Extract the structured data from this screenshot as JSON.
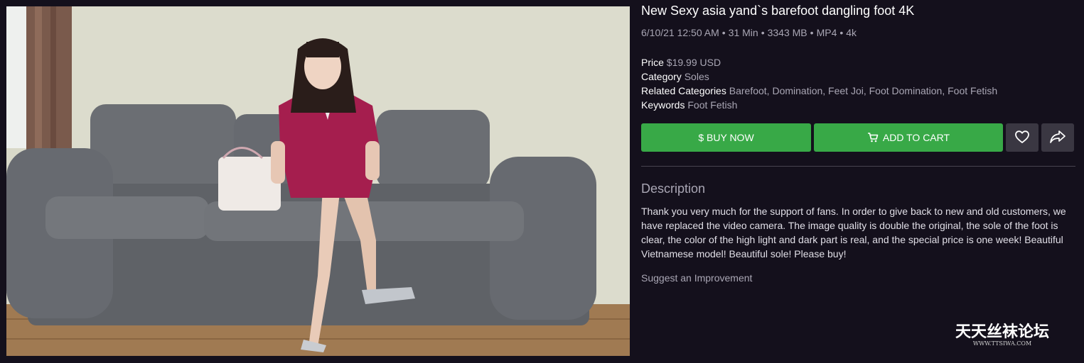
{
  "product": {
    "title": "New Sexy asia yand`s barefoot dangling foot 4K",
    "meta": {
      "date": "6/10/21 12:50 AM",
      "duration": "31 Min",
      "size": "3343 MB",
      "format": "MP4",
      "quality": "4k",
      "separator": "•"
    },
    "details": {
      "price_label": "Price",
      "price_value": "$19.99 USD",
      "category_label": "Category",
      "category_value": "Soles",
      "related_label": "Related Categories",
      "related_value": "Barefoot, Domination, Feet Joi, Foot Domination, Foot Fetish",
      "keywords_label": "Keywords",
      "keywords_value": "Foot Fetish"
    }
  },
  "actions": {
    "buy_label": "$ BUY NOW",
    "cart_label": "ADD TO CART",
    "cart_icon": "cart-icon",
    "favorite_icon": "heart-icon",
    "share_icon": "share-icon",
    "accent_color": "#38a947"
  },
  "description": {
    "heading": "Description",
    "text": "Thank you very much for the support of fans. In order to give back to new and old customers, we have replaced the video camera. The image quality is double the original, the sole of the foot is clear, the color of the high light and dark part is real, and the special price is one week! Beautiful Vietnamese model! Beautiful sole! Please buy!",
    "suggest_link": "Suggest an Improvement"
  },
  "watermark": {
    "main": "天天丝袜论坛",
    "sub": "WWW.TTSIWA.COM"
  }
}
